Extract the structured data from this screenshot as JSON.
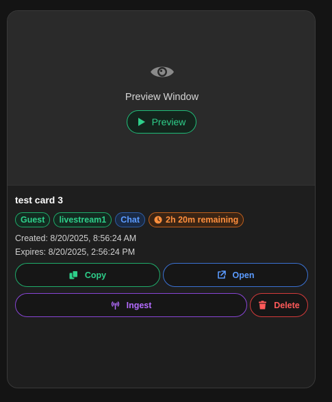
{
  "preview": {
    "window_label": "Preview Window",
    "button_label": "Preview",
    "icon": "eye-icon"
  },
  "card": {
    "title": "test card 3",
    "badges": {
      "guest": "Guest",
      "stream": "livestream1",
      "chat": "Chat",
      "remaining": "2h 20m remaining"
    },
    "created": "Created: 8/20/2025, 8:56:24 AM",
    "expires": "Expires: 8/20/2025, 2:56:24 PM"
  },
  "actions": {
    "copy": "Copy",
    "open": "Open",
    "ingest": "Ingest",
    "delete": "Delete"
  },
  "colors": {
    "green": "#2ecf8a",
    "blue": "#5b9bff",
    "orange": "#ff8f3d",
    "purple": "#b46cff",
    "red": "#ff5a5a"
  }
}
